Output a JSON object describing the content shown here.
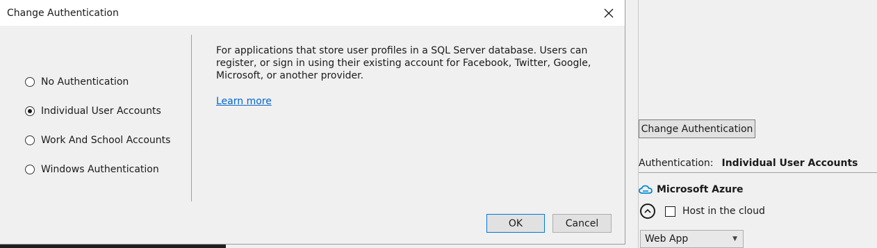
{
  "dialog": {
    "title": "Change Authentication",
    "options": [
      {
        "label": "No Authentication",
        "selected": false
      },
      {
        "label": "Individual User Accounts",
        "selected": true
      },
      {
        "label": "Work And School Accounts",
        "selected": false
      },
      {
        "label": "Windows Authentication",
        "selected": false
      }
    ],
    "description": "For applications that store user profiles in a SQL Server database. Users can register, or sign in using their existing account for Facebook, Twitter, Google, Microsoft, or another provider.",
    "learn_more": "Learn more",
    "ok_label": "OK",
    "cancel_label": "Cancel"
  },
  "side_panel": {
    "change_auth_button": "Change Authentication",
    "auth_label": "Authentication:",
    "auth_value": "Individual User Accounts",
    "azure_title": "Microsoft Azure",
    "host_label": "Host in the cloud",
    "host_checked": false,
    "webapp_select": "Web App"
  },
  "colors": {
    "link": "#0066cc",
    "ok_border": "#0078d7",
    "azure_icon": "#0089d6"
  }
}
